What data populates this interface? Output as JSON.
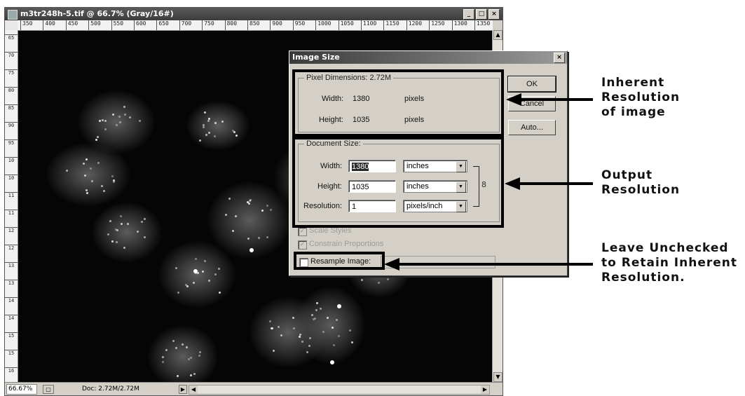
{
  "window": {
    "title": "m3tr248h-5.tif @ 66.7% (Gray/16#)",
    "minimize": "_",
    "maximize": "□",
    "close": "×"
  },
  "ruler_top_labels": [
    "350",
    "400",
    "450",
    "500",
    "550",
    "600",
    "650",
    "700",
    "750",
    "800",
    "850",
    "900",
    "950",
    "1000",
    "1050",
    "1100",
    "1150",
    "1200",
    "1250",
    "1300",
    "1350"
  ],
  "ruler_left_labels": [
    "650",
    "700",
    "750",
    "800",
    "850",
    "900",
    "950",
    "1000",
    "1050",
    "1100",
    "1150",
    "1200",
    "1250",
    "1300",
    "1350",
    "1400",
    "1450",
    "1500",
    "1550",
    "1600"
  ],
  "status_bar": {
    "zoom": "66.67%",
    "doc_info": "Doc: 2.72M/2.72M",
    "menu_arrow": "▶",
    "scroll_left": "◀",
    "scroll_right": "▶"
  },
  "scrollbar": {
    "up": "▲",
    "down": "▼"
  },
  "dialog": {
    "title": "Image Size",
    "close": "×",
    "pixel_dimensions": {
      "label": "Pixel Dimensions:",
      "value": "2.72M",
      "width_label": "Width:",
      "width_value": "1380",
      "width_unit": "pixels",
      "height_label": "Height:",
      "height_value": "1035",
      "height_unit": "pixels"
    },
    "document_size": {
      "label": "Document Size:",
      "width_label": "Width:",
      "width_value": "1380",
      "width_unit": "inches",
      "height_label": "Height:",
      "height_value": "1035",
      "height_unit": "inches",
      "resolution_label": "Resolution:",
      "resolution_value": "1",
      "resolution_unit": "pixels/inch"
    },
    "buttons": {
      "ok": "OK",
      "cancel": "Cancel",
      "auto": "Auto..."
    },
    "scale_styles": {
      "label": "Scale Styles",
      "checked": true
    },
    "constrain_proportions": {
      "label": "Constrain Proportions",
      "checked": true
    },
    "resample_image": {
      "label": "Resample Image:",
      "checked": false
    },
    "dropdown_glyph": "▼",
    "link_glyph": "8"
  },
  "annotations": {
    "inherent": [
      "Inherent",
      "Resolution",
      "of image"
    ],
    "output": [
      "Output",
      "Resolution"
    ],
    "leave": [
      "Leave Unchecked",
      "to Retain Inherent",
      "Resolution."
    ]
  },
  "colors": {
    "dialog_bg": "#d4d0c8",
    "canvas_bg": "#050505",
    "highlight_box": "#000000"
  }
}
